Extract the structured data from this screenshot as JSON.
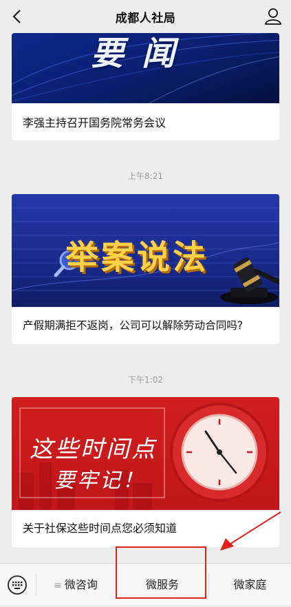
{
  "header": {
    "title": "成都人社局"
  },
  "feed": [
    {
      "banner_text": "要闻",
      "caption": "李强主持召开国务院常务会议"
    },
    {
      "timestamp": "上午8:21",
      "banner_text": "举案说法",
      "caption": "产假期满拒不返岗，公司可以解除劳动合同吗?"
    },
    {
      "timestamp": "下午1:02",
      "banner_line1": "这些时间点",
      "banner_line2": "要牢记！",
      "caption": "关于社保这些时间点您必须知道"
    }
  ],
  "bottom_menu": {
    "items": [
      {
        "label": "微咨询"
      },
      {
        "label": "微服务"
      },
      {
        "label": "微家庭"
      }
    ]
  },
  "colors": {
    "background": "#ededed",
    "annotation_red": "#e0201b",
    "banner1_blue": "#0b2a8a",
    "banner2_blue": "#1d2f9a",
    "banner3_red": "#c8161b"
  },
  "icons": [
    "back-arrow-icon",
    "profile-icon",
    "keyboard-icon",
    "menu-lines-icon",
    "magnifier-icon",
    "gavel-icon",
    "clock-icon"
  ]
}
